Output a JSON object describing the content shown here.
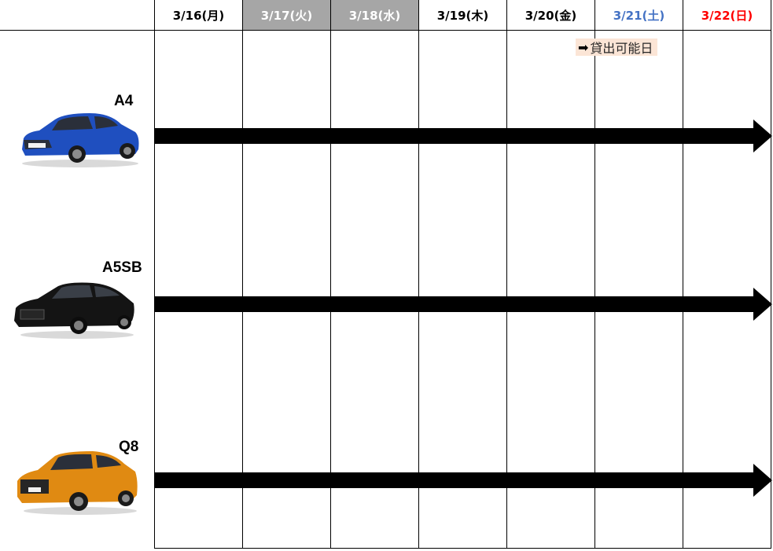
{
  "header": {
    "days": [
      {
        "label": "3/16(月)",
        "state": "normal"
      },
      {
        "label": "3/17(火)",
        "state": "closed"
      },
      {
        "label": "3/18(水)",
        "state": "closed"
      },
      {
        "label": "3/19(木)",
        "state": "normal"
      },
      {
        "label": "3/20(金)",
        "state": "normal"
      },
      {
        "label": "3/21(土)",
        "state": "saturday"
      },
      {
        "label": "3/22(日)",
        "state": "sunday"
      }
    ]
  },
  "legend": {
    "arrow": "➡",
    "text": "貸出可能日",
    "background": "#fbe5d6"
  },
  "cars": [
    {
      "name": "A4",
      "color": "#1f4fbf",
      "availability": "3/16(月) - 3/22(日)"
    },
    {
      "name": "A5SB",
      "color": "#141414",
      "availability": "3/16(月) - 3/22(日)"
    },
    {
      "name": "Q8",
      "color": "#e08a12",
      "availability": "3/16(月) - 3/22(日)"
    }
  ],
  "colors": {
    "closed_day_bg": "#a6a6a6",
    "saturday_text": "#4472c4",
    "sunday_text": "#ff0000",
    "grid": "#000000"
  }
}
